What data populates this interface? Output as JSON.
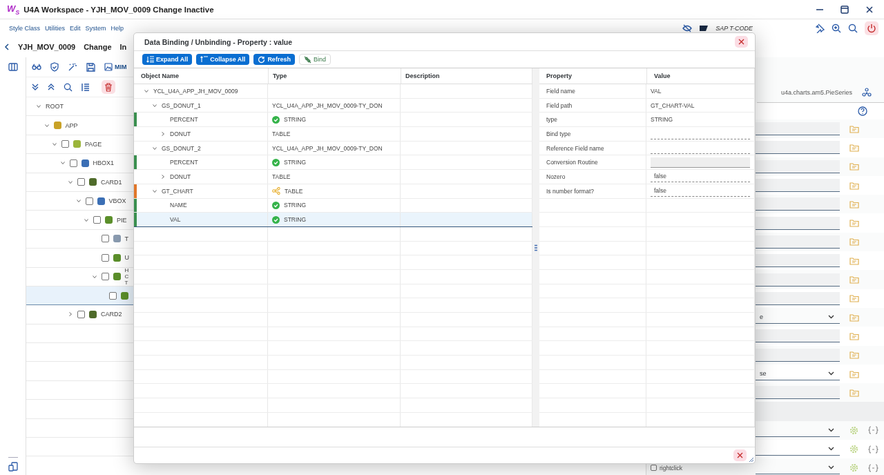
{
  "window": {
    "logo": "W$_{S}$",
    "title": "U4A Workspace - YJH_MOV_0009 Change Inactive"
  },
  "menu": [
    "Style Class",
    "Utilities",
    "Edit",
    "System",
    "Help"
  ],
  "top_right": {
    "tcode_label": "SAP T-CODE"
  },
  "header": {
    "app_id": "YJH_MOV_0009",
    "mode": "Change",
    "status": "In"
  },
  "toolbar": {
    "mime_label": "MIM"
  },
  "tree": [
    {
      "label": "ROOT",
      "expanded": true,
      "selected": false,
      "children": [
        {
          "label": "APP",
          "kind": "app",
          "expanded": true,
          "selected": false,
          "children": [
            {
              "label": "PAGE",
              "kind": "page",
              "checked": false,
              "expanded": true,
              "selected": false,
              "children": [
                {
                  "label": "HBOX1",
                  "kind": "hbox",
                  "checked": false,
                  "expanded": true,
                  "selected": false,
                  "children": [
                    {
                      "label": "CARD1",
                      "kind": "card",
                      "checked": false,
                      "expanded": true,
                      "selected": false,
                      "children": [
                        {
                          "label": "VBOX",
                          "kind": "vbox",
                          "checked": false,
                          "expanded": true,
                          "selected": false,
                          "children": [
                            {
                              "label": "PIE",
                              "kind": "chart",
                              "checked": false,
                              "expanded": true,
                              "selected": false,
                              "children": [
                                {
                                  "label": "T",
                                  "kind": "text",
                                  "checked": false,
                                  "selected": false
                                },
                                {
                                  "label": "U",
                                  "kind": "chart",
                                  "checked": false,
                                  "selected": false
                                },
                                {
                                  "label": "H C T",
                                  "kind": "chart",
                                  "checked": false,
                                  "expanded": true,
                                  "selected": false,
                                  "children": [
                                    {
                                      "kind": "chart",
                                      "checked": false,
                                      "selected": true
                                    }
                                  ]
                                }
                              ]
                            }
                          ]
                        }
                      ]
                    },
                    {
                      "label": "CARD2",
                      "kind": "card",
                      "checked": false,
                      "expanded": false,
                      "selected": false
                    }
                  ]
                }
              ]
            }
          ]
        }
      ]
    }
  ],
  "right_panel": {
    "class_name": "u4a.charts.am5.PieSeries",
    "rows": [
      {
        "kind": "input"
      },
      {
        "kind": "input"
      },
      {
        "kind": "input"
      },
      {
        "kind": "input"
      },
      {
        "kind": "input"
      },
      {
        "kind": "input"
      },
      {
        "kind": "input"
      },
      {
        "kind": "input"
      },
      {
        "kind": "input"
      },
      {
        "kind": "input"
      },
      {
        "kind": "select",
        "value": "e"
      },
      {
        "kind": "input"
      },
      {
        "kind": "input"
      },
      {
        "kind": "select",
        "value": "se"
      },
      {
        "kind": "input"
      },
      {
        "kind": "blank"
      },
      {
        "kind": "bind-select"
      },
      {
        "kind": "bind-select"
      },
      {
        "kind": "bind-select",
        "checkbox": {
          "label": "rightclick",
          "checked": false
        }
      }
    ]
  },
  "dialog": {
    "title": "Data Binding / Unbinding - Property : value",
    "buttons": [
      {
        "label": "Expand All",
        "kind": "expand"
      },
      {
        "label": "Collapse All",
        "kind": "collapse"
      },
      {
        "label": "Refresh",
        "kind": "refresh"
      },
      {
        "label": "Bind",
        "kind": "bind"
      }
    ],
    "columns": [
      "Object Name",
      "Type",
      "Description"
    ],
    "rows": [
      {
        "name": "YCL_U4A_APP_JH_MOV_0009",
        "expanded": true,
        "selected": false,
        "children": [
          {
            "name": "GS_DONUT_1",
            "type": "YCL_U4A_APP_JH_MOV_0009-TY_DON",
            "expanded": true,
            "selected": false,
            "children": [
              {
                "name": "PERCENT",
                "type": "STRING",
                "kind": "field",
                "color": "#3a8f4f",
                "selected": false
              },
              {
                "name": "DONUT",
                "type": "TABLE",
                "expanded": false,
                "selected": false
              }
            ]
          },
          {
            "name": "GS_DONUT_2",
            "type": "YCL_U4A_APP_JH_MOV_0009-TY_DON",
            "expanded": true,
            "selected": false,
            "children": [
              {
                "name": "PERCENT",
                "type": "STRING",
                "kind": "field",
                "color": "#3a8f4f",
                "selected": false
              },
              {
                "name": "DONUT",
                "type": "TABLE",
                "expanded": false,
                "selected": false
              }
            ]
          },
          {
            "name": "GT_CHART",
            "type": "TABLE",
            "kind": "linked",
            "color": "#e0762a",
            "expanded": true,
            "selected": false,
            "children": [
              {
                "name": "NAME",
                "type": "STRING",
                "kind": "field",
                "color": "#3a8f4f",
                "selected": false
              },
              {
                "name": "VAL",
                "type": "STRING",
                "kind": "field",
                "color": "#3a8f4f",
                "selected": true
              }
            ]
          }
        ]
      }
    ],
    "property_columns": [
      "Property",
      "Value"
    ],
    "properties": [
      {
        "name": "Field name",
        "value": "VAL",
        "kind": "text"
      },
      {
        "name": "Field path",
        "value": "GT_CHART-VAL",
        "kind": "text"
      },
      {
        "name": "type",
        "value": "STRING",
        "kind": "text"
      },
      {
        "name": "Bind type",
        "kind": "input"
      },
      {
        "name": "Reference Field name",
        "kind": "input"
      },
      {
        "name": "Conversion Routine",
        "kind": "disabled"
      },
      {
        "name": "Nozero",
        "value": "false",
        "kind": "input"
      },
      {
        "name": "Is number format?",
        "value": "false",
        "kind": "input"
      }
    ]
  }
}
